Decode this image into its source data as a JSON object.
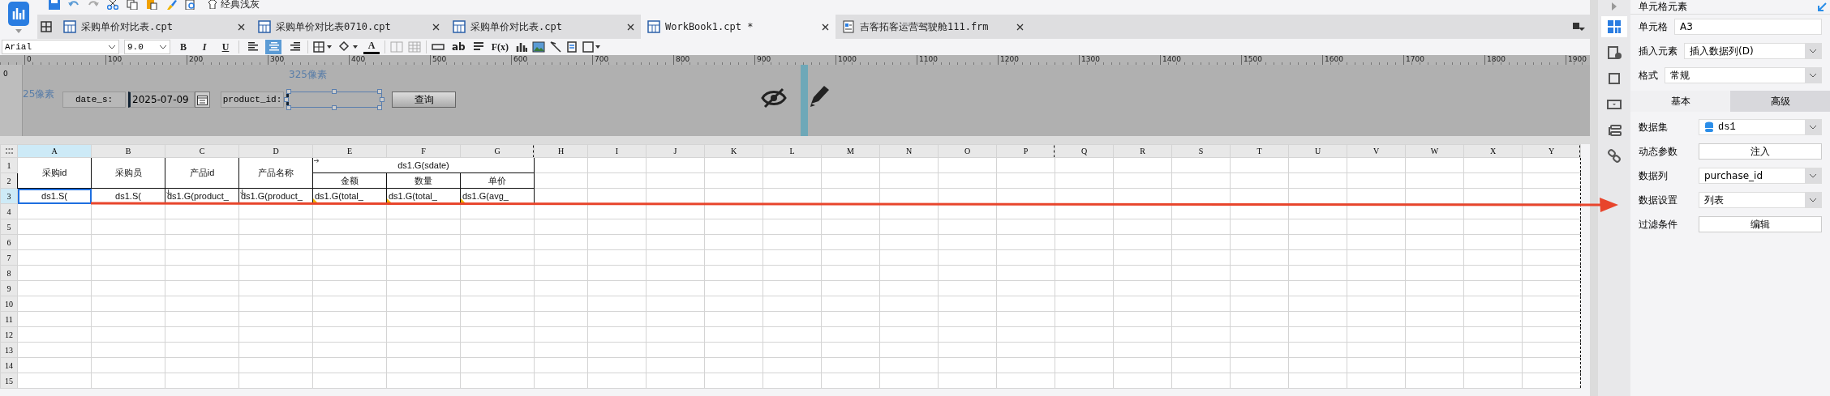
{
  "toolbar": {
    "theme_button": "经典浅灰"
  },
  "tabs": [
    {
      "label": "采购单价对比表.cpt",
      "kind": "report",
      "selected": false
    },
    {
      "label": "采购单价对比表0710.cpt",
      "kind": "report",
      "selected": false
    },
    {
      "label": "采购单价对比表.cpt",
      "kind": "report",
      "selected": false
    },
    {
      "label": "WorkBook1.cpt *",
      "kind": "report",
      "selected": true
    },
    {
      "label": "吉客拓客运营驾驶舱111.frm",
      "kind": "form",
      "selected": false
    }
  ],
  "format_bar": {
    "font": "Arial",
    "size": "9.0",
    "bold": "B",
    "italic": "I",
    "underline": "U",
    "font_color": "A",
    "alignments": [
      {
        "kind": "left",
        "selected": false
      },
      {
        "kind": "center",
        "selected": true
      },
      {
        "kind": "right",
        "selected": false
      }
    ],
    "text_tool": "ab",
    "formula_tool": "F(x)"
  },
  "ruler": [
    "0",
    "100",
    "200",
    "300",
    "400",
    "500",
    "600",
    "700",
    "800",
    "900",
    "1000",
    "1100",
    "1200",
    "1300",
    "1400",
    "1500",
    "1600",
    "1700",
    "1800",
    "1900"
  ],
  "parameter_pane": {
    "vertical_ruler": "0",
    "width_hint": "325像素",
    "height_hint": "25像素",
    "params": [
      {
        "label": "date_s:",
        "kind": "date",
        "value": "2025-07-09",
        "selected": false
      },
      {
        "label": "product_id:",
        "kind": "text",
        "selected": true
      }
    ],
    "query_button": "查询"
  },
  "sheet": {
    "columns": [
      {
        "name": "A",
        "selected": true,
        "page_break": false
      },
      {
        "name": "B",
        "selected": false,
        "page_break": false
      },
      {
        "name": "C",
        "selected": false,
        "page_break": false
      },
      {
        "name": "D",
        "selected": false,
        "page_break": false
      },
      {
        "name": "E",
        "selected": false,
        "page_break": false
      },
      {
        "name": "F",
        "selected": false,
        "page_break": false
      },
      {
        "name": "G",
        "selected": false,
        "page_break": true
      },
      {
        "name": "H",
        "selected": false,
        "page_break": false
      },
      {
        "name": "I",
        "selected": false,
        "page_break": false
      },
      {
        "name": "J",
        "selected": false,
        "page_break": false
      },
      {
        "name": "K",
        "selected": false,
        "page_break": false
      },
      {
        "name": "L",
        "selected": false,
        "page_break": false
      },
      {
        "name": "M",
        "selected": false,
        "page_break": false
      },
      {
        "name": "N",
        "selected": false,
        "page_break": false
      },
      {
        "name": "O",
        "selected": false,
        "page_break": false
      },
      {
        "name": "P",
        "selected": false,
        "page_break": true
      },
      {
        "name": "Q",
        "selected": false,
        "page_break": false
      },
      {
        "name": "R",
        "selected": false,
        "page_break": false
      },
      {
        "name": "S",
        "selected": false,
        "page_break": false
      },
      {
        "name": "T",
        "selected": false,
        "page_break": false
      },
      {
        "name": "U",
        "selected": false,
        "page_break": false
      },
      {
        "name": "V",
        "selected": false,
        "page_break": false
      },
      {
        "name": "W",
        "selected": false,
        "page_break": false
      },
      {
        "name": "X",
        "selected": false,
        "page_break": false
      },
      {
        "name": "Y",
        "selected": false,
        "page_break": true
      }
    ],
    "rows": [
      {
        "name": "1",
        "selected": false
      },
      {
        "name": "2",
        "selected": false
      },
      {
        "name": "3",
        "selected": true
      },
      {
        "name": "4",
        "selected": false
      },
      {
        "name": "5",
        "selected": false
      },
      {
        "name": "6",
        "selected": false
      },
      {
        "name": "7",
        "selected": false
      },
      {
        "name": "8",
        "selected": false
      },
      {
        "name": "9",
        "selected": false
      },
      {
        "name": "10",
        "selected": false
      },
      {
        "name": "11",
        "selected": false
      },
      {
        "name": "12",
        "selected": false
      },
      {
        "name": "13",
        "selected": false
      },
      {
        "name": "14",
        "selected": false
      },
      {
        "name": "15",
        "selected": false
      }
    ],
    "tall_headers": [
      "采购id",
      "采购员",
      "产品id",
      "产品名称"
    ],
    "group_header": {
      "text": "ds1.G(sdate)",
      "expand_arrow": true,
      "subheaders": [
        "金额",
        "数量",
        "单价"
      ]
    },
    "data_row": [
      {
        "text": "ds1.S(",
        "selected": true,
        "expand_arrow": false,
        "corner_mark": false
      },
      {
        "text": "ds1.S(",
        "selected": false,
        "expand_arrow": false,
        "corner_mark": false
      },
      {
        "text": "ds1.G(product_",
        "selected": false,
        "expand_arrow": true,
        "corner_mark": false
      },
      {
        "text": "ds1.G(product_",
        "selected": false,
        "expand_arrow": true,
        "corner_mark": false
      },
      {
        "text": "ds1.G(total_",
        "selected": false,
        "expand_arrow": false,
        "corner_mark": true
      },
      {
        "text": "ds1.G(total_",
        "selected": false,
        "expand_arrow": false,
        "corner_mark": true
      },
      {
        "text": "ds1.G(avg_",
        "selected": false,
        "expand_arrow": false,
        "corner_mark": true
      }
    ]
  },
  "side_icons": [
    {
      "kind": "cell",
      "selected": true
    },
    {
      "kind": "info",
      "selected": false
    },
    {
      "kind": "frame",
      "selected": false
    },
    {
      "kind": "dropdown",
      "selected": false
    },
    {
      "kind": "widget",
      "selected": false
    },
    {
      "kind": "link",
      "selected": false
    }
  ],
  "panel": {
    "title": "单元格元素",
    "top_rows": [
      {
        "label": "单元格",
        "kind": "input",
        "value": "A3"
      },
      {
        "label": "插入元素",
        "kind": "select",
        "value": "插入数据列(D)"
      },
      {
        "label": "格式",
        "kind": "select",
        "value": "常规"
      }
    ],
    "tabs": [
      {
        "label": "基本",
        "selected": true
      },
      {
        "label": "高级",
        "selected": false
      }
    ],
    "rows": [
      {
        "label": "数据集",
        "kind": "dataset",
        "value": "ds1"
      },
      {
        "label": "动态参数",
        "kind": "button",
        "value": "注入"
      },
      {
        "label": "数据列",
        "kind": "select",
        "value": "purchase_id"
      },
      {
        "label": "数据设置",
        "kind": "select",
        "value": "列表"
      },
      {
        "label": "过滤条件",
        "kind": "button",
        "value": "编辑"
      }
    ]
  }
}
